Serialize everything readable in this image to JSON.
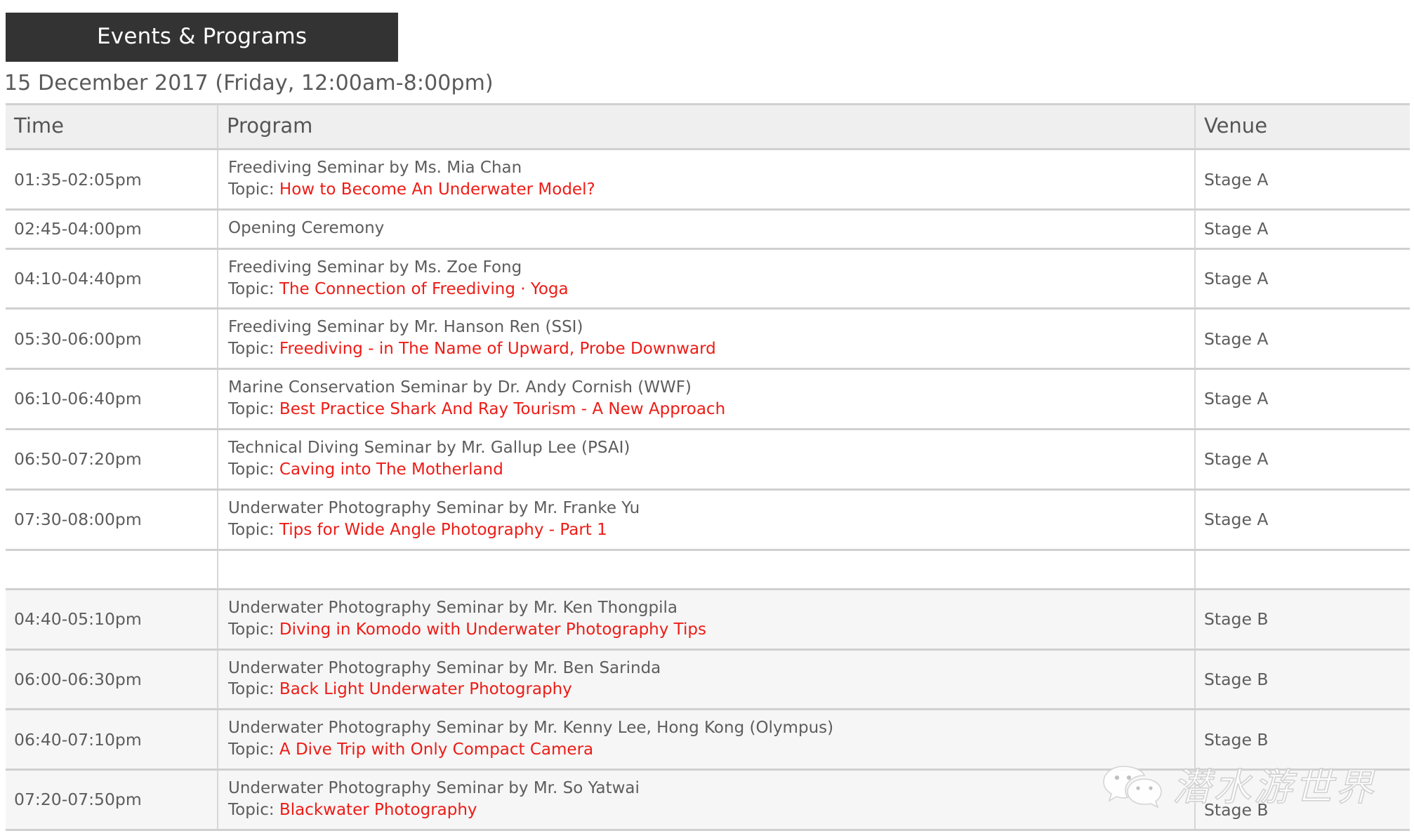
{
  "banner": {
    "title": "Events & Programs"
  },
  "date_line": "15 December 2017 (Friday, 12:00am-8:00pm)",
  "table": {
    "headers": {
      "time": "Time",
      "program": "Program",
      "venue": "Venue"
    },
    "topic_label": "Topic: ",
    "rows": [
      {
        "time": "01:35-02:05pm",
        "title": "Freediving Seminar by Ms. Mia Chan",
        "topic": "How to Become An Underwater Model?",
        "venue": "Stage A"
      },
      {
        "time": "02:45-04:00pm",
        "title": "Opening Ceremony",
        "topic": "",
        "venue": "Stage A"
      },
      {
        "time": "04:10-04:40pm",
        "title": "Freediving Seminar by Ms. Zoe Fong",
        "topic": "The Connection of Freediving · Yoga",
        "venue": "Stage A"
      },
      {
        "time": "05:30-06:00pm",
        "title": "Freediving Seminar by Mr. Hanson Ren (SSI)",
        "topic": "Freediving - in The Name of Upward, Probe Downward",
        "venue": "Stage A"
      },
      {
        "time": "06:10-06:40pm",
        "title": "Marine Conservation Seminar by Dr. Andy Cornish (WWF)",
        "topic": "Best Practice Shark And Ray Tourism - A New Approach",
        "venue": "Stage A"
      },
      {
        "time": "06:50-07:20pm",
        "title": "Technical Diving Seminar by Mr. Gallup Lee (PSAI)",
        "topic": "Caving into The Motherland",
        "venue": "Stage A"
      },
      {
        "time": "07:30-08:00pm",
        "title": "Underwater Photography Seminar by Mr. Franke Yu",
        "topic": "Tips for Wide Angle Photography - Part 1",
        "venue": "Stage A"
      },
      {
        "time": "",
        "title": "",
        "topic": "",
        "venue": ""
      },
      {
        "time": "04:40-05:10pm",
        "title": "Underwater Photography Seminar by Mr. Ken Thongpila",
        "topic": "Diving in Komodo with Underwater Photography Tips",
        "venue": "Stage B"
      },
      {
        "time": "06:00-06:30pm",
        "title": "Underwater Photography Seminar by Mr. Ben Sarinda",
        "topic": "Back Light Underwater Photography",
        "venue": "Stage B"
      },
      {
        "time": "06:40-07:10pm",
        "title": "Underwater Photography Seminar by Mr. Kenny Lee, Hong Kong (Olympus)",
        "topic": "A Dive Trip with Only Compact Camera",
        "venue": "Stage B"
      },
      {
        "time": "07:20-07:50pm",
        "title": "Underwater Photography Seminar by Mr. So Yatwai",
        "topic": "Blackwater Photography",
        "venue": "Stage B"
      }
    ]
  },
  "watermark": {
    "text": "潜水游世界",
    "icon": "wechat-icon"
  },
  "colors": {
    "banner_bg": "#333333",
    "topic_red": "#ed1c16",
    "header_bg": "#efefef",
    "border": "#d0d0d0",
    "alt_row_bg": "#f6f6f6",
    "text": "#5d5d5d"
  }
}
